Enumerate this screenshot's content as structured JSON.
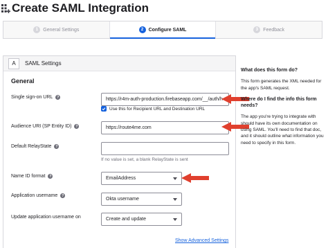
{
  "header": {
    "title": "Create SAML Integration",
    "icon": "app-grid-plus-icon"
  },
  "steps": [
    {
      "num": "1",
      "label": "General Settings",
      "state": "inactive"
    },
    {
      "num": "2",
      "label": "Configure SAML",
      "state": "active"
    },
    {
      "num": "3",
      "label": "Feedback",
      "state": "inactive"
    }
  ],
  "form": {
    "section_letter": "A",
    "section_title": "SAML Settings",
    "group_title": "General",
    "sso_url": {
      "label": "Single sign-on URL",
      "value": "https://r4m-auth-production.firebaseapp.com/__/auth/h",
      "checkbox_label": "Use this for Recipient URL and Destination URL",
      "checked": true
    },
    "audience_uri": {
      "label": "Audience URI (SP Entity ID)",
      "value": "https://route4me.com"
    },
    "relay_state": {
      "label": "Default RelayState",
      "value": "",
      "hint": "If no value is set, a blank RelayState is sent"
    },
    "name_id_format": {
      "label": "Name ID format",
      "value": "EmailAddress"
    },
    "app_username": {
      "label": "Application username",
      "value": "Okta username"
    },
    "update_username": {
      "label": "Update application username on",
      "value": "Create and update"
    },
    "advanced_link": "Show Advanced Settings"
  },
  "sidebar": {
    "q1": "What does this form do?",
    "a1": "This form generates the XML needed for the app's SAML request.",
    "q2": "Where do I find the info this form needs?",
    "a2": "The app you're trying to integrate with should have its own documentation on using SAML. You'll need to find that doc, and it should outline what information you need to specify in this form."
  },
  "colors": {
    "accent": "#1662dd",
    "annotation_arrow": "#e0402e"
  }
}
